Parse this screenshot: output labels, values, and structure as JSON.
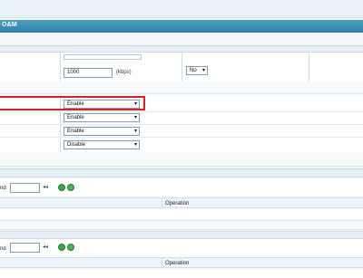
{
  "header": {
    "title": "O&M"
  },
  "rate": {
    "value": "1000",
    "unit": "(kbps)",
    "option": "No"
  },
  "selects": [
    {
      "value": "Enable"
    },
    {
      "value": "Enable"
    },
    {
      "value": "Enable"
    },
    {
      "value": "Disable"
    }
  ],
  "section1": {
    "label": "nd",
    "operation": "Operation"
  },
  "section2": {
    "label": "nd",
    "operation": "Operation"
  },
  "icons": {
    "back": "◂◂"
  }
}
